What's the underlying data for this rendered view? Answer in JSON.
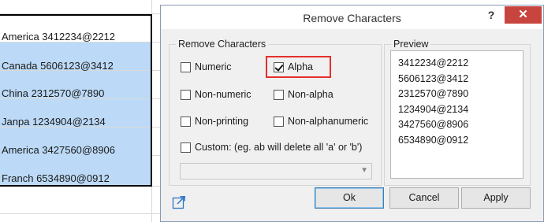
{
  "sheet": {
    "rows": [
      {
        "text": "America 3412234@2212",
        "selected": false
      },
      {
        "text": "Canada 5606123@3412",
        "selected": true
      },
      {
        "text": "China 2312570@7890",
        "selected": true
      },
      {
        "text": "Janpa 1234904@2134",
        "selected": true
      },
      {
        "text": "America 3427560@8906",
        "selected": true
      },
      {
        "text": "Franch 6534890@0912",
        "selected": true
      }
    ]
  },
  "dialog": {
    "title": "Remove Characters",
    "help_label": "?",
    "close_label": "✕",
    "options_group": {
      "legend": "Remove Characters",
      "numeric": {
        "label": "Numeric",
        "checked": false
      },
      "alpha": {
        "label": "Alpha",
        "checked": true
      },
      "non_numeric": {
        "label": "Non-numeric",
        "checked": false
      },
      "non_alpha": {
        "label": "Non-alpha",
        "checked": false
      },
      "non_printing": {
        "label": "Non-printing",
        "checked": false
      },
      "non_alphanumeric": {
        "label": "Non-alphanumeric",
        "checked": false
      },
      "custom": {
        "label": "Custom: (eg. ab will delete all 'a' or 'b')",
        "checked": false
      },
      "custom_value": ""
    },
    "preview": {
      "legend": "Preview",
      "lines": [
        "3412234@2212",
        "5606123@3412",
        "2312570@7890",
        "1234904@2134",
        "3427560@8906",
        "6534890@0912"
      ]
    },
    "buttons": {
      "ok": "Ok",
      "cancel": "Cancel",
      "apply": "Apply"
    },
    "icons": {
      "expand": "expand-icon",
      "combo_arrow": "chevron-down-icon"
    },
    "colors": {
      "selection": "#bcdaf7",
      "highlight": "#e5302b",
      "close": "#c7453e"
    }
  }
}
